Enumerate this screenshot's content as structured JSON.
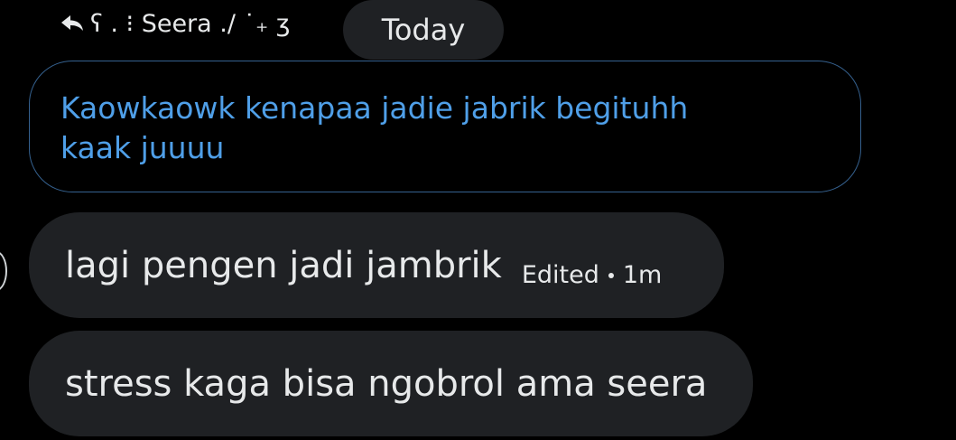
{
  "reply_header": {
    "icon": "reply-arrow-icon",
    "name": "ʕ . ⁝ Seera ./ ˙₊ ʒ"
  },
  "date_separator": {
    "label": "Today"
  },
  "quoted_message": {
    "text": "Kaowkaowk kenapaa jadie jabrik begituhh\nkaak juuuu"
  },
  "messages": [
    {
      "text": "lagi pengen jadi jambrik",
      "edited_label": "Edited",
      "time": "1m"
    },
    {
      "text": "stress kaga bisa ngobrol ama seera"
    }
  ],
  "colors": {
    "background": "#000000",
    "bubble": "#1f2124",
    "text": "#e7e9ea",
    "quoted_text": "#4f9fe8",
    "quoted_border": "#35618f"
  }
}
